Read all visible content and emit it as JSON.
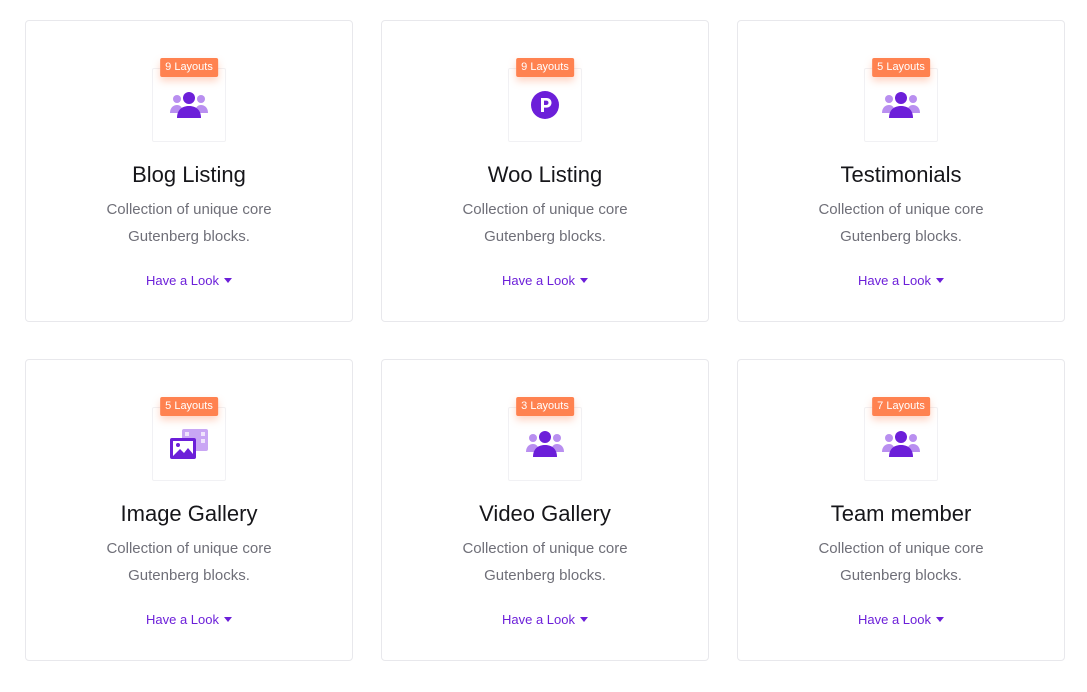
{
  "colors": {
    "accent": "#6c1fd9",
    "badge": "#ff8250",
    "icon_light": "#b98ff0"
  },
  "cards": [
    {
      "badge": "9 Layouts",
      "icon": "users-icon",
      "title": "Blog Listing",
      "desc_line1": "Collection of unique core",
      "desc_line2": "Gutenberg blocks.",
      "link": "Have a Look"
    },
    {
      "badge": "9 Layouts",
      "icon": "product-p-icon",
      "title": "Woo Listing",
      "desc_line1": "Collection of unique core",
      "desc_line2": "Gutenberg blocks.",
      "link": "Have a Look"
    },
    {
      "badge": "5 Layouts",
      "icon": "users-icon",
      "title": "Testimonials",
      "desc_line1": "Collection of unique core",
      "desc_line2": "Gutenberg blocks.",
      "link": "Have a Look"
    },
    {
      "badge": "5 Layouts",
      "icon": "image-gallery-icon",
      "title": "Image Gallery",
      "desc_line1": "Collection of unique core",
      "desc_line2": "Gutenberg blocks.",
      "link": "Have a Look"
    },
    {
      "badge": "3 Layouts",
      "icon": "users-icon",
      "title": "Video Gallery",
      "desc_line1": "Collection of unique core",
      "desc_line2": "Gutenberg blocks.",
      "link": "Have a Look"
    },
    {
      "badge": "7 Layouts",
      "icon": "users-icon",
      "title": "Team member",
      "desc_line1": "Collection of unique core",
      "desc_line2": "Gutenberg blocks.",
      "link": "Have a Look"
    }
  ]
}
